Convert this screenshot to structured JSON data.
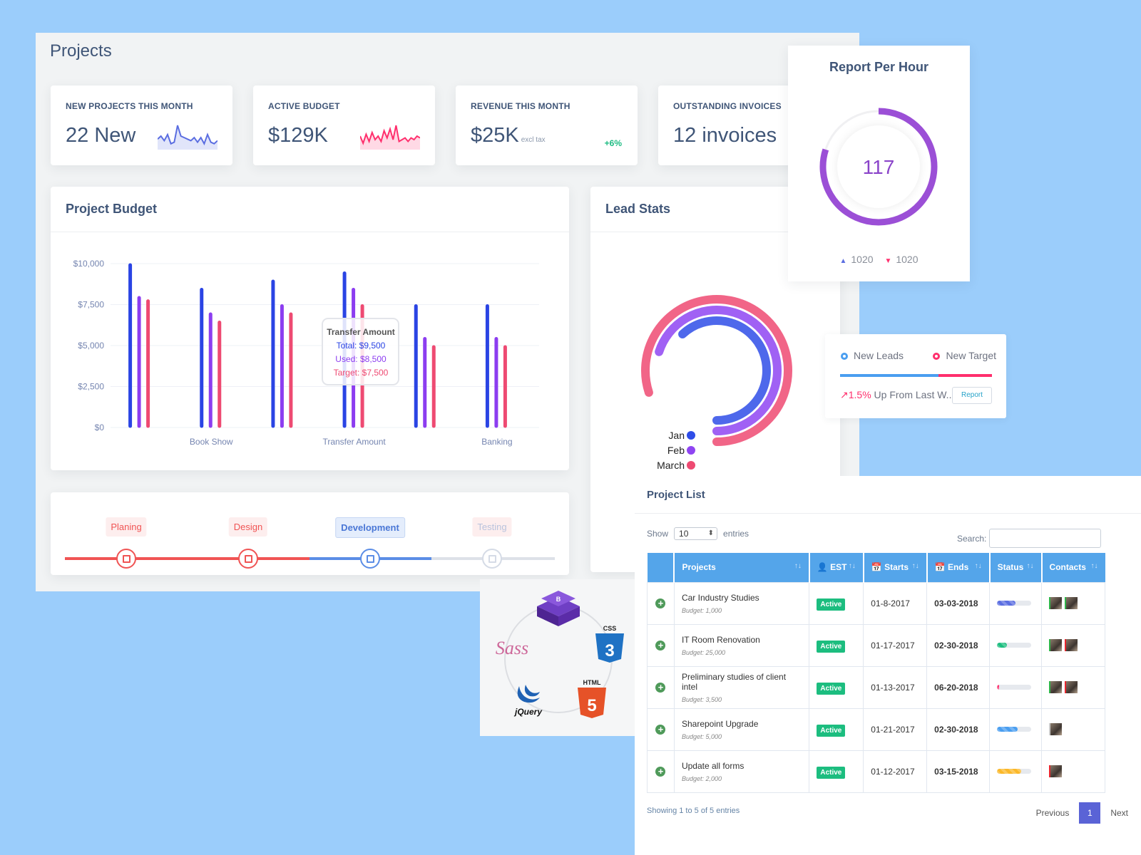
{
  "page": {
    "title": "Projects"
  },
  "stats": [
    {
      "label": "NEW PROJECTS THIS MONTH",
      "value": "22 New",
      "sparkline": [
        5,
        7,
        4,
        8,
        2,
        3,
        14,
        7,
        6,
        5,
        4,
        6,
        3,
        6,
        2,
        8,
        3,
        2,
        4
      ],
      "color": "#5b6ee1"
    },
    {
      "label": "ACTIVE BUDGET",
      "value": "$129K",
      "sparkline": [
        6,
        2,
        7,
        3,
        8,
        4,
        6,
        3,
        9,
        5,
        10,
        4,
        12,
        3,
        4,
        5,
        3,
        5,
        4,
        6,
        5
      ],
      "color": "#ff2f6d"
    },
    {
      "label": "REVENUE THIS MONTH",
      "value": "$25K",
      "sub": "excl tax",
      "delta": "+6%"
    },
    {
      "label": "OUTSTANDING INVOICES",
      "value": "12 invoices"
    }
  ],
  "budget": {
    "title": "Project Budget",
    "tooltip": {
      "title": "Transfer Amount",
      "total": "Total: $9,500",
      "used": "Used: $8,500",
      "target": "Target: $7,500"
    }
  },
  "chart_data": [
    {
      "type": "bar",
      "title": "Project Budget",
      "categories": [
        "",
        "Book Show",
        "",
        "Transfer Amount",
        "",
        "Banking"
      ],
      "series": [
        {
          "name": "Total",
          "color": "#2a44e4",
          "values": [
            10000,
            8500,
            9000,
            9500,
            7500,
            7500
          ]
        },
        {
          "name": "Used",
          "color": "#8c3df0",
          "values": [
            8000,
            7000,
            7500,
            8500,
            5500,
            5500
          ]
        },
        {
          "name": "Target",
          "color": "#ee4a72",
          "values": [
            7800,
            6500,
            7000,
            7500,
            5000,
            5000
          ]
        }
      ],
      "yticks": [
        "$0",
        "$2,500",
        "$5,000",
        "$7,500",
        "$10,000"
      ],
      "ylim": [
        0,
        10000
      ],
      "grid": true
    },
    {
      "type": "radialBar",
      "title": "Lead Stats",
      "series": [
        {
          "name": "Jan",
          "color": "#2f4de8",
          "value": 0.62
        },
        {
          "name": "Feb",
          "color": "#8f45f2",
          "value": 0.7
        },
        {
          "name": "March",
          "color": "#ee4a72",
          "value": 0.8
        }
      ]
    },
    {
      "type": "gauge",
      "title": "Report Per Hour",
      "value": 117,
      "fraction": 0.8
    }
  ],
  "timeline": {
    "steps": [
      {
        "label": "Planing",
        "state": "done"
      },
      {
        "label": "Design",
        "state": "done"
      },
      {
        "label": "Development",
        "state": "current"
      },
      {
        "label": "Testing",
        "state": "pending"
      }
    ]
  },
  "lead_stats": {
    "title": "Lead Stats",
    "legend": [
      "Jan",
      "Feb",
      "March"
    ]
  },
  "report": {
    "title": "Report Per Hour",
    "value": "117",
    "up": "1020",
    "down": "1020"
  },
  "leads_widget": {
    "new_leads": "New Leads",
    "new_target": "New Target",
    "leads_fraction": 0.65,
    "pct": "1.5%",
    "text": "Up From Last W...",
    "report_button": "Report"
  },
  "tech": [
    "Bootstrap",
    "CSS3",
    "HTML5",
    "jQuery",
    "Sass"
  ],
  "project_list": {
    "title": "Project List",
    "show_label": "Show",
    "show_value": "10",
    "entries_label": "entries",
    "search_label": "Search:",
    "search_value": "",
    "columns": [
      "",
      "Projects",
      "EST",
      "Starts",
      "Ends",
      "Status",
      "Contacts"
    ],
    "rows": [
      {
        "name": "Car Industry Studies",
        "budget": "Budget: 1,000",
        "est": "Active",
        "start": "01-8-2017",
        "end": "03-03-2018",
        "progress": 0.55,
        "color": "#5b6ee1",
        "contacts": [
          "#2fb54a",
          "#2fb54a"
        ]
      },
      {
        "name": "IT Room Renovation",
        "budget": "Budget: 25,000",
        "est": "Active",
        "start": "01-17-2017",
        "end": "02-30-2018",
        "progress": 0.3,
        "color": "#1cbd7f",
        "contacts": [
          "#2fb54a",
          "#e8262e"
        ]
      },
      {
        "name": "Preliminary studies of client intel",
        "budget": "Budget: 3,500",
        "est": "Active",
        "start": "01-13-2017",
        "end": "06-20-2018",
        "progress": 0.06,
        "color": "#ff2f6d",
        "contacts": [
          "#2fb54a",
          "#e8262e"
        ]
      },
      {
        "name": "Sharepoint Upgrade",
        "budget": "Budget: 5,000",
        "est": "Active",
        "start": "01-21-2017",
        "end": "02-30-2018",
        "progress": 0.6,
        "color": "#4a9ef0",
        "contacts": [
          "#ccc"
        ]
      },
      {
        "name": "Update all forms",
        "budget": "Budget: 2,000",
        "est": "Active",
        "start": "01-12-2017",
        "end": "03-15-2018",
        "progress": 0.7,
        "color": "#fbb829",
        "contacts": [
          "#e8262e"
        ]
      }
    ],
    "showing": "Showing 1 to 5 of 5 entries",
    "previous": "Previous",
    "page": "1",
    "next": "Next"
  }
}
